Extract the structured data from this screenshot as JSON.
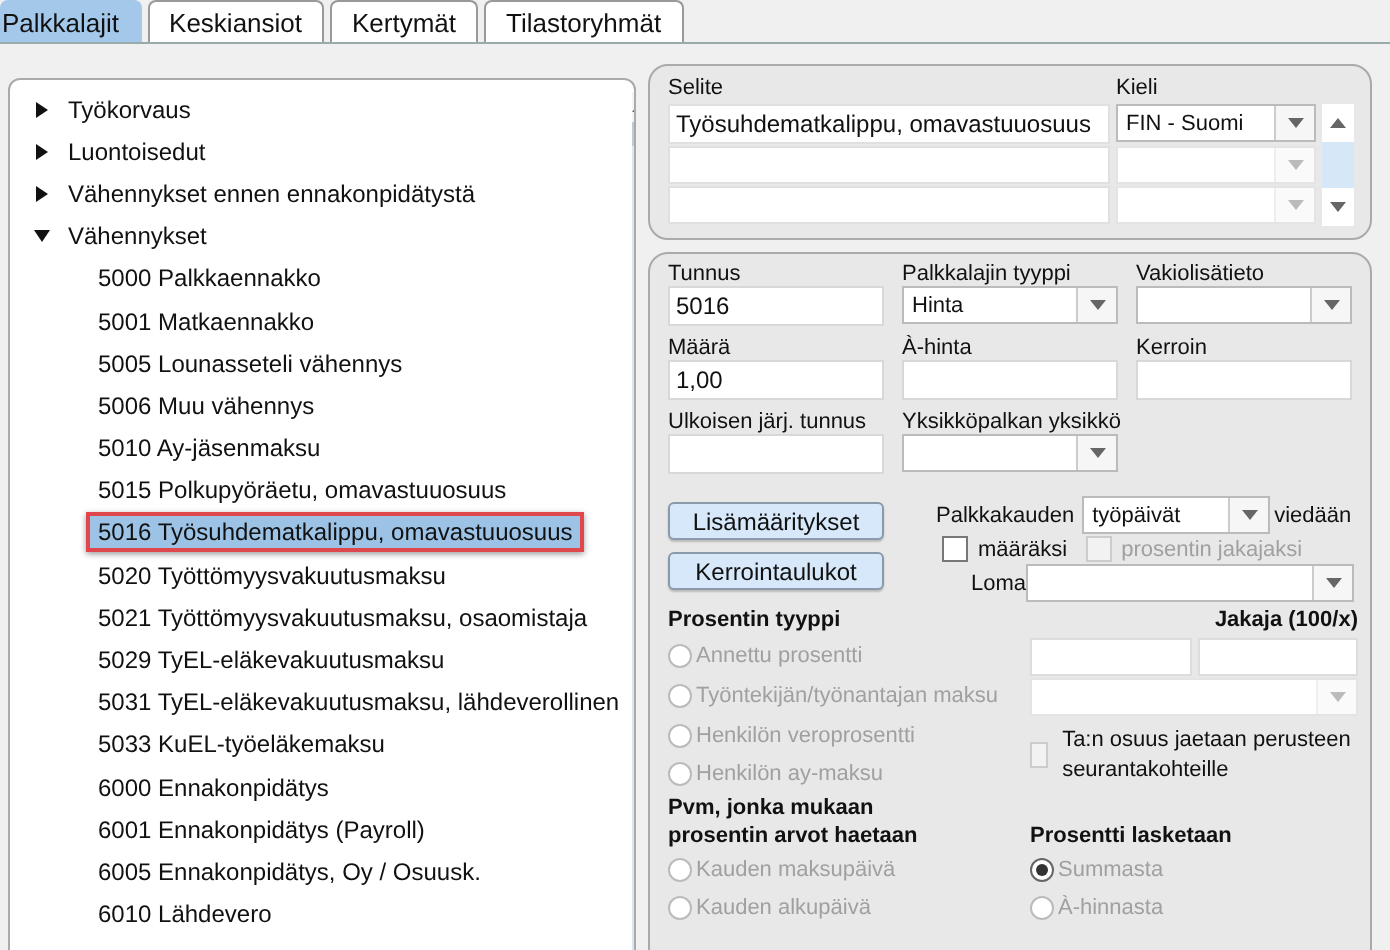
{
  "tabs": [
    {
      "label": "Palkkalajit",
      "selected": true
    },
    {
      "label": "Keskiansiot",
      "selected": false
    },
    {
      "label": "Kertymät",
      "selected": false
    },
    {
      "label": "Tilastoryhmät",
      "selected": false
    }
  ],
  "tree": {
    "items": [
      {
        "label": "Työkorvaus",
        "expanded": false
      },
      {
        "label": "Luontoisedut",
        "expanded": false
      },
      {
        "label": "Vähennykset ennen ennakonpidätystä",
        "expanded": false
      },
      {
        "label": "Vähennykset",
        "expanded": true,
        "children": [
          {
            "label": "5000 Palkkaennakko",
            "selected": false
          },
          {
            "label": "5001 Matkaennakko",
            "selected": false
          },
          {
            "label": "5005 Lounasseteli vähennys",
            "selected": false
          },
          {
            "label": "5006 Muu vähennys",
            "selected": false
          },
          {
            "label": "5010 Ay-jäsenmaksu",
            "selected": false
          },
          {
            "label": "5015 Polkupyöräetu, omavastuuosuus",
            "selected": false
          },
          {
            "label": "5016 Työsuhdematkalippu, omavastuuosuus",
            "selected": true
          },
          {
            "label": "5020 Työttömyysvakuutusmaksu",
            "selected": false
          },
          {
            "label": "5021 Työttömyysvakuutusmaksu, osaomistaja",
            "selected": false
          },
          {
            "label": "5029 TyEL-eläkevakuutusmaksu",
            "selected": false
          },
          {
            "label": "5031 TyEL-eläkevakuutusmaksu, lähdeverollinen",
            "selected": false
          },
          {
            "label": "5033 KuEL-työeläkemaksu",
            "selected": false
          },
          {
            "label": "6000 Ennakonpidätys",
            "selected": false
          },
          {
            "label": "6001 Ennakonpidätys (Payroll)",
            "selected": false
          },
          {
            "label": "6005 Ennakonpidätys, Oy / Osuusk.",
            "selected": false
          },
          {
            "label": "6010 Lähdevero",
            "selected": false
          }
        ]
      }
    ]
  },
  "descriptions": {
    "text_header": "Selite",
    "language_header": "Kieli",
    "rows": [
      {
        "text": "Työsuhdematkalippu, omavastuuosuus",
        "language": "FIN - Suomi",
        "disabled": false
      },
      {
        "disabled": true
      },
      {
        "disabled": true
      }
    ]
  },
  "fields": [
    {
      "kind": "text",
      "label": "Tunnus",
      "value": "5016"
    },
    {
      "kind": "select",
      "label": "Palkkalajin tyyppi",
      "value": "Hinta"
    },
    {
      "kind": "select",
      "label": "Vakiolisätieto"
    },
    {
      "kind": "number",
      "label": "Määrä",
      "value": "1,00"
    },
    {
      "kind": "text",
      "label": "À-hinta"
    },
    {
      "kind": "text",
      "label": "Kerroin"
    },
    {
      "kind": "text",
      "label": "Ulkoisen järj. tunnus"
    },
    {
      "kind": "select",
      "label": "Yksikköpalkan yksikkö"
    }
  ],
  "buttons": [
    "Lisämääritykset",
    "Kerrointaulukot"
  ],
  "period": {
    "label": "Palkkakauden",
    "value": "työpäivät",
    "suffix": "viedään"
  },
  "period_checkboxes": [
    {
      "label": "määräksi",
      "checked": false,
      "disabled": false
    },
    {
      "label": "prosentin jakajaksi",
      "checked": false,
      "disabled": true
    }
  ],
  "holiday": {
    "label": "Loma"
  },
  "percent_type": {
    "title": "Prosentin tyyppi",
    "options": [
      {
        "label": "Annettu prosentti",
        "selected": false,
        "disabled": true
      },
      {
        "label": "Työntekijän/työnantajan maksu",
        "selected": false,
        "disabled": true
      },
      {
        "label": "Henkilön veroprosentti",
        "selected": false,
        "disabled": true
      },
      {
        "label": "Henkilön ay-maksu",
        "selected": false,
        "disabled": true
      }
    ]
  },
  "divisor": {
    "label": "Jakaja (100/x)"
  },
  "split_checkbox": {
    "label": "Ta:n osuus jaetaan perusteen seurantakohteille",
    "checked": false,
    "disabled": true
  },
  "date_basis": {
    "title": "Pvm, jonka mukaan prosentin arvot haetaan",
    "options": [
      {
        "label": "Kauden maksupäivä",
        "selected": false,
        "disabled": true
      },
      {
        "label": "Kauden alkupäivä",
        "selected": false,
        "disabled": true
      }
    ]
  },
  "calc_basis": {
    "title": "Prosentti lasketaan",
    "options": [
      {
        "label": "Summasta",
        "selected": true,
        "disabled": true
      },
      {
        "label": "À-hinnasta",
        "selected": false,
        "disabled": true
      }
    ]
  }
}
